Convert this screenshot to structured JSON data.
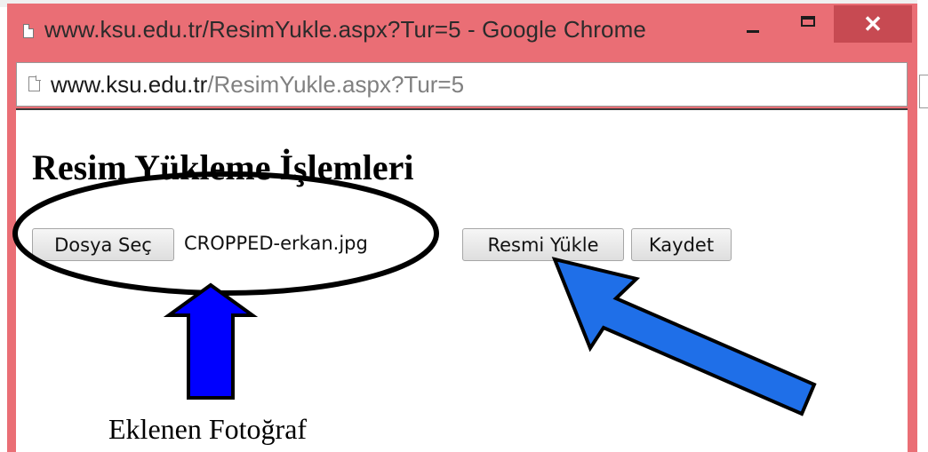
{
  "window": {
    "title": "www.ksu.edu.tr/ResimYukle.aspx?Tur=5 - Google Chrome",
    "minimize_icon": "minimize-icon",
    "maximize_icon": "maximize-icon",
    "close_label": "✕"
  },
  "address_bar": {
    "domain": "www.ksu.edu.tr",
    "path": "/ResimYukle.aspx?Tur=5",
    "icon": "page-icon"
  },
  "page": {
    "heading": "Resim Yükleme İşlemleri",
    "choose_file_label": "Dosya Seç",
    "file_name": "CROPPED-erkan.jpg",
    "upload_label": "Resmi Yükle",
    "save_label": "Kaydet"
  },
  "annotation": {
    "caption": "Eklenen Fotoğraf",
    "ellipse_color": "#000000",
    "arrow_color_up": "#0000ff",
    "arrow_color_diagonal": "#1f6fe8"
  },
  "colors": {
    "window_frame": "#ea6e75",
    "close_button": "#c74a52"
  }
}
